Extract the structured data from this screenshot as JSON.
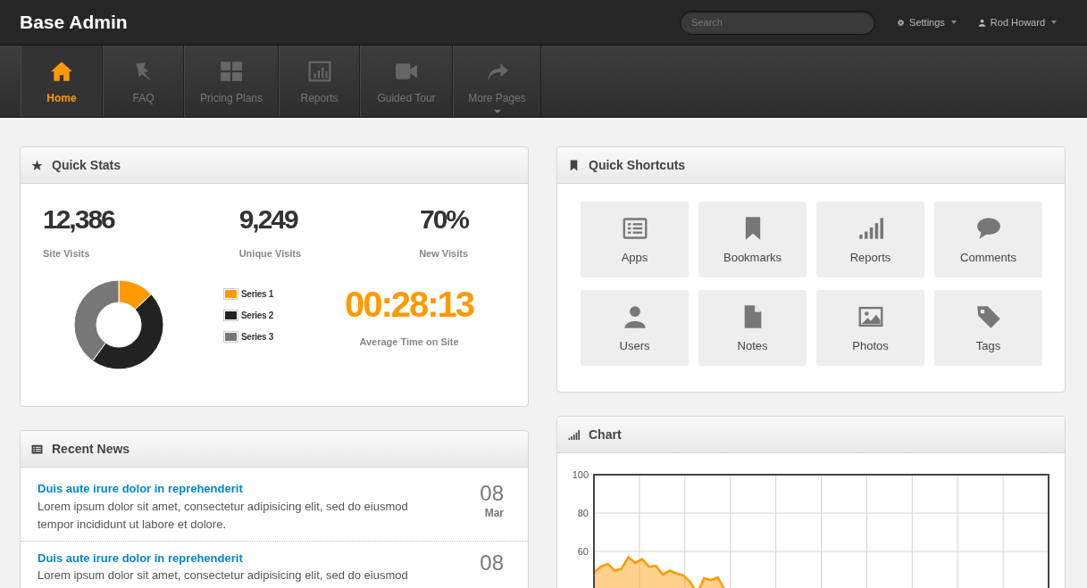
{
  "app": {
    "title": "Base Admin"
  },
  "topbar": {
    "search": {
      "placeholder": "Search"
    },
    "menus": [
      {
        "label": "Settings",
        "kind": "gear"
      },
      {
        "label": "Rod Howard",
        "kind": "user"
      }
    ]
  },
  "nav": [
    {
      "label": "Home",
      "kind": "home",
      "selected": true,
      "dropdown": false
    },
    {
      "label": "FAQ",
      "kind": "pin",
      "selected": false,
      "dropdown": false
    },
    {
      "label": "Pricing Plans",
      "kind": "grid",
      "selected": false,
      "dropdown": false
    },
    {
      "label": "Reports",
      "kind": "bars",
      "selected": false,
      "dropdown": false
    },
    {
      "label": "Guided Tour",
      "kind": "video",
      "selected": false,
      "dropdown": false
    },
    {
      "label": "More Pages",
      "kind": "share",
      "selected": false,
      "dropdown": true
    }
  ],
  "quick_stats": {
    "title": "Quick Stats",
    "stats": [
      {
        "value": "12,386",
        "label": "Site Visits"
      },
      {
        "value": "9,249",
        "label": "Unique Visits"
      },
      {
        "value": "70%",
        "label": "New Visits"
      }
    ],
    "chart_data": {
      "type": "donut",
      "categories": [
        "Series 1",
        "Series 2",
        "Series 3"
      ],
      "values": [
        13,
        47,
        40
      ],
      "colors": [
        "#ff9900",
        "#222222",
        "#777777"
      ],
      "legend": "right"
    },
    "time": {
      "value": "00:28:13",
      "label": "Average Time on Site"
    }
  },
  "news": {
    "title": "Recent News",
    "items": [
      {
        "title": "Duis aute irure dolor in reprehenderit",
        "body": "Lorem ipsum dolor sit amet, consectetur adipisicing elit, sed do eiusmod tempor incididunt ut labore et dolore.",
        "day": "08",
        "month": "Mar"
      },
      {
        "title": "Duis aute irure dolor in reprehenderit",
        "body": "Lorem ipsum dolor sit amet, consectetur adipisicing elit, sed do eiusmod",
        "day": "08"
      }
    ]
  },
  "shortcuts": {
    "title": "Quick Shortcuts",
    "items": [
      {
        "label": "Apps",
        "kind": "list"
      },
      {
        "label": "Bookmarks",
        "kind": "bookmark"
      },
      {
        "label": "Reports",
        "kind": "signal"
      },
      {
        "label": "Comments",
        "kind": "comment"
      },
      {
        "label": "Users",
        "kind": "user"
      },
      {
        "label": "Notes",
        "kind": "file"
      },
      {
        "label": "Photos",
        "kind": "picture"
      },
      {
        "label": "Tags",
        "kind": "tag"
      }
    ]
  },
  "chart_panel": {
    "title": "Chart",
    "axis_labels": [
      "100",
      "80",
      "60"
    ]
  }
}
